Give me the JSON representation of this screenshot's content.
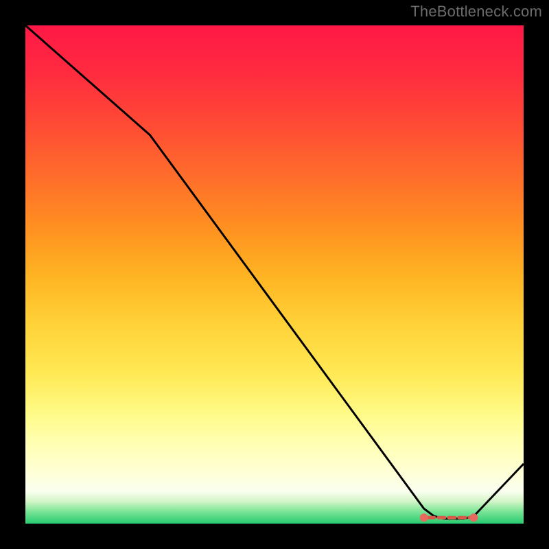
{
  "attribution": "TheBottleneck.com",
  "chart_data": {
    "type": "line",
    "title": "",
    "xlabel": "",
    "ylabel": "",
    "xlim": [
      0,
      100
    ],
    "ylim": [
      0,
      100
    ],
    "background_gradient": {
      "stops": [
        {
          "offset": 0.0,
          "color": "#ff1846"
        },
        {
          "offset": 0.1,
          "color": "#ff2c3f"
        },
        {
          "offset": 0.2,
          "color": "#ff4b34"
        },
        {
          "offset": 0.3,
          "color": "#ff6c2b"
        },
        {
          "offset": 0.4,
          "color": "#ff8e21"
        },
        {
          "offset": 0.5,
          "color": "#ffb322"
        },
        {
          "offset": 0.6,
          "color": "#ffd238"
        },
        {
          "offset": 0.7,
          "color": "#ffe955"
        },
        {
          "offset": 0.78,
          "color": "#fffb88"
        },
        {
          "offset": 0.84,
          "color": "#ffffb3"
        },
        {
          "offset": 0.9,
          "color": "#ffffd8"
        },
        {
          "offset": 0.935,
          "color": "#fafff0"
        },
        {
          "offset": 0.955,
          "color": "#d4f5c8"
        },
        {
          "offset": 0.975,
          "color": "#7de597"
        },
        {
          "offset": 1.0,
          "color": "#28cb70"
        }
      ]
    },
    "series": [
      {
        "name": "bottleneck-curve",
        "x": [
          0,
          25,
          80,
          82,
          84,
          86,
          88,
          90,
          100
        ],
        "y": [
          100,
          78,
          3,
          1.5,
          1.0,
          1.0,
          1.0,
          1.5,
          12
        ],
        "stroke": "#000000",
        "stroke_width_px": 3
      }
    ],
    "optimal_band": {
      "name": "optimal-range",
      "x_start": 80,
      "x_end": 90,
      "y_level": 1.2,
      "marker_color": "#e86a5f",
      "dash_color": "#d85a4a"
    }
  }
}
